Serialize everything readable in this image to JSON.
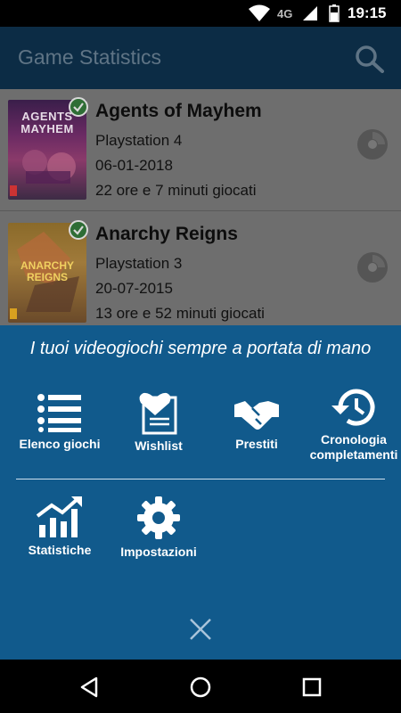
{
  "status_bar": {
    "network": "4G",
    "time": "19:15",
    "icons": [
      "wifi-icon",
      "signal-icon",
      "battery-icon"
    ]
  },
  "app_bar": {
    "title": "Game Statistics",
    "search_icon": "search-icon"
  },
  "games": [
    {
      "title": "Agents of Mayhem",
      "platform": "Playstation 4",
      "date": "06-01-2018",
      "playtime": "22 ore e 7 minuti giocati",
      "cover_text": "AGENTS MAYHEM",
      "completed": true
    },
    {
      "title": "Anarchy Reigns",
      "platform": "Playstation 3",
      "date": "20-07-2015",
      "playtime": "13 ore e 52 minuti giocati",
      "cover_text": "ANARCHY REIGNS",
      "completed": true
    }
  ],
  "menu": {
    "headline": "I tuoi videogiochi sempre a portata di mano",
    "items": [
      {
        "label": "Elenco giochi",
        "icon": "list-icon"
      },
      {
        "label": "Wishlist",
        "icon": "wishlist-heart-icon"
      },
      {
        "label": "Prestiti",
        "icon": "handshake-icon"
      },
      {
        "label": "Cronologia completamenti",
        "icon": "history-icon"
      },
      {
        "label": "Statistiche",
        "icon": "chart-icon"
      },
      {
        "label": "Impostazioni",
        "icon": "gear-icon"
      }
    ],
    "close_icon": "close-icon"
  },
  "colors": {
    "app_bar": "#0c2c45",
    "menu_panel": "#115a8c",
    "dimmed_list": "#6e6e6e",
    "check_badge": "#2e6d35"
  },
  "nav_bar": {
    "icons": [
      "back-icon",
      "home-icon",
      "recents-icon"
    ]
  }
}
